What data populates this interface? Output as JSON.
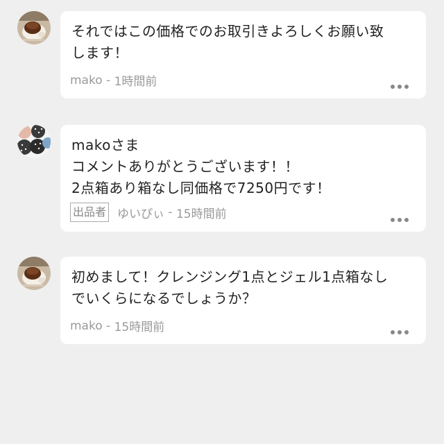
{
  "comments": [
    {
      "text": "それではこの価格でのお取引きよろしくお願い致\nします！",
      "author": "mako",
      "separator": " - ",
      "time": "1時間前",
      "seller_badge": ""
    },
    {
      "text": "makoさま\nコメントありがとうございます！！\n2点箱あり箱なし同価格で7250円です！",
      "author": "ゆいぴぃ",
      "separator": " - ",
      "time": "15時間前",
      "seller_badge": "出品者"
    },
    {
      "text": "初めまして！クレンジング1点とジェル1点箱なし\nでいくらになるでしょうか？",
      "author": "mako",
      "separator": " - ",
      "time": "15時間前",
      "seller_badge": ""
    }
  ],
  "icons": {
    "more": "more-dots-icon",
    "avatar_buyer": "pudding-avatar",
    "avatar_seller": "dotted-pattern-avatar"
  },
  "colors": {
    "background": "#efefef",
    "bubble": "#ffffff",
    "text": "#222222",
    "meta": "#999999"
  }
}
